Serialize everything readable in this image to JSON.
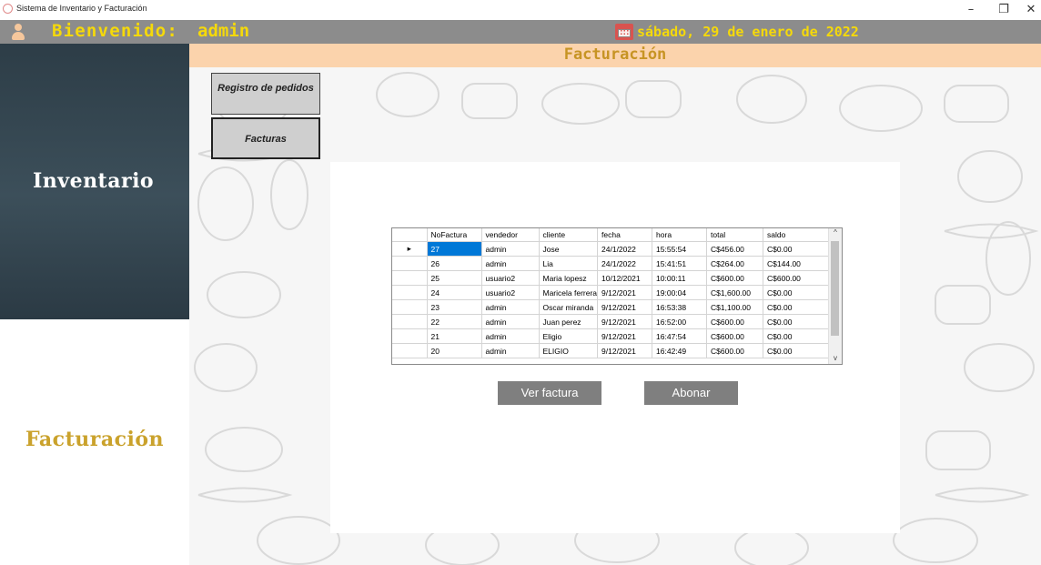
{
  "window": {
    "title": "Sistema de Inventario y Facturación",
    "controls": {
      "minimize": "–",
      "restore": "❐",
      "close": "✕"
    }
  },
  "header": {
    "welcome": "Bienvenido:",
    "username": "admin",
    "date": "sábado, 29 de enero de 2022",
    "icons": {
      "user": "user-icon",
      "calendar": "calendar-icon"
    }
  },
  "sidebar": {
    "items": [
      {
        "label": "Inventario"
      },
      {
        "label": "Facturación"
      }
    ]
  },
  "section": {
    "title": "Facturación"
  },
  "submenu": {
    "registro_label": "Registro de pedidos",
    "facturas_label": "Facturas"
  },
  "table": {
    "columns": [
      "NoFactura",
      "vendedor",
      "cliente",
      "fecha",
      "hora",
      "total",
      "saldo"
    ],
    "rows": [
      [
        "27",
        "admin",
        "Jose",
        "24/1/2022",
        "15:55:54",
        "C$456.00",
        "C$0.00"
      ],
      [
        "26",
        "admin",
        "Lia",
        "24/1/2022",
        "15:41:51",
        "C$264.00",
        "C$144.00"
      ],
      [
        "25",
        "usuario2",
        "Maria lopesz",
        "10/12/2021",
        "10:00:11",
        "C$600.00",
        "C$600.00"
      ],
      [
        "24",
        "usuario2",
        "Maricela ferrera",
        "9/12/2021",
        "19:00:04",
        "C$1,600.00",
        "C$0.00"
      ],
      [
        "23",
        "admin",
        "Oscar miranda",
        "9/12/2021",
        "16:53:38",
        "C$1,100.00",
        "C$0.00"
      ],
      [
        "22",
        "admin",
        "Juan perez",
        "9/12/2021",
        "16:52:00",
        "C$600.00",
        "C$0.00"
      ],
      [
        "21",
        "admin",
        "Eligio",
        "9/12/2021",
        "16:47:54",
        "C$600.00",
        "C$0.00"
      ],
      [
        "20",
        "admin",
        "ELIGIO",
        "9/12/2021",
        "16:42:49",
        "C$600.00",
        "C$0.00"
      ]
    ],
    "current_row_marker": "▸"
  },
  "actions": {
    "ver_factura": "Ver factura",
    "abonar": "Abonar"
  },
  "colors": {
    "header_bg": "#8c8c8c",
    "header_text": "#f5d90a",
    "sidebar_dark": "#34454f",
    "accent_gold": "#caa22c",
    "section_bg": "#fbd3ac",
    "selection": "#0078d7",
    "button_gray": "#7f7f7f"
  }
}
